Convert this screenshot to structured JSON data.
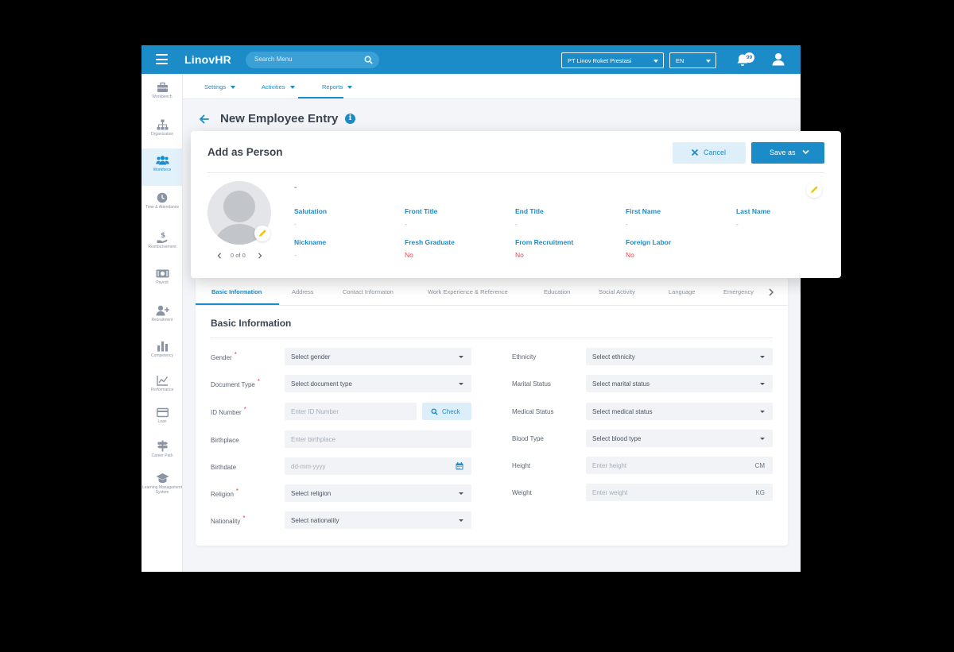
{
  "topbar": {
    "brand": "LinovHR",
    "search_placeholder": "Search Menu",
    "company": "PT Linov Roket Prestasi",
    "language": "EN",
    "notification_count": "99"
  },
  "sidebar": {
    "items": [
      {
        "label": "Workbench",
        "icon": "briefcase-icon"
      },
      {
        "label": "Organization",
        "icon": "org-chart-icon"
      },
      {
        "label": "Workforce",
        "icon": "people-icon"
      },
      {
        "label": "Time & Attendance",
        "icon": "clock-icon"
      },
      {
        "label": "Reimbursement",
        "icon": "hand-dollar-icon"
      },
      {
        "label": "Payroll",
        "icon": "money-icon"
      },
      {
        "label": "Recruitment",
        "icon": "add-user-icon"
      },
      {
        "label": "Competency",
        "icon": "bar-chart-icon"
      },
      {
        "label": "Performance",
        "icon": "line-chart-icon"
      },
      {
        "label": "Loan",
        "icon": "card-icon"
      },
      {
        "label": "Career Path",
        "icon": "signpost-icon"
      },
      {
        "label": "Learning Management System",
        "icon": "graduation-cap-icon"
      }
    ]
  },
  "subnav": {
    "settings": "Settings",
    "activities": "Activities",
    "reports": "Reports"
  },
  "page": {
    "title": "New Employee Entry"
  },
  "modal": {
    "title": "Add as Person",
    "cancel": "Cancel",
    "save": "Save as",
    "name_value": "-",
    "pager": "0 of 0",
    "fields": [
      {
        "label": "Salutation",
        "value": "-"
      },
      {
        "label": "Front Title",
        "value": "-"
      },
      {
        "label": "End Title",
        "value": "-"
      },
      {
        "label": "First Name",
        "value": "-"
      },
      {
        "label": "Last Name",
        "value": "-"
      },
      {
        "label": "Nickname",
        "value": "-"
      },
      {
        "label": "Fresh Graduate",
        "value": "No"
      },
      {
        "label": "From Recruitment",
        "value": "No"
      },
      {
        "label": "Foreign Labor",
        "value": "No"
      }
    ]
  },
  "tabs": [
    "Basic Information",
    "Address",
    "Contact Informaton",
    "Work Experience & Reference",
    "Education",
    "Social Activity",
    "Language",
    "Emergency"
  ],
  "form": {
    "section_title": "Basic Information",
    "left": [
      {
        "label": "Gender",
        "required": "*",
        "value": "Select gender"
      },
      {
        "label": "Document Type",
        "required": "*",
        "value": "Select document type"
      },
      {
        "label": "ID Number",
        "required": "*",
        "placeholder": "Enter ID Number",
        "button": "Check"
      },
      {
        "label": "Birthplace",
        "placeholder": "Enter birthplace"
      },
      {
        "label": "Birthdate",
        "placeholder": "dd-mm-yyyy"
      },
      {
        "label": "Religion",
        "required": "*",
        "value": "Select religion"
      },
      {
        "label": "Nationality",
        "required": "*",
        "value": "Select nationality"
      }
    ],
    "right": [
      {
        "label": "Ethnicity",
        "value": "Select ethnicity"
      },
      {
        "label": "Marital Status",
        "value": "Select marital status"
      },
      {
        "label": "Medical Status",
        "value": "Select medical status"
      },
      {
        "label": "Blood Type",
        "value": "Select blood type"
      },
      {
        "label": "Height",
        "placeholder": "Enter height",
        "unit": "CM"
      },
      {
        "label": "Weight",
        "placeholder": "Enter weight",
        "unit": "KG"
      }
    ]
  },
  "colors": {
    "primary": "#1b8cc8",
    "required": "#e5484d",
    "edit_icon": "#f2c500"
  }
}
